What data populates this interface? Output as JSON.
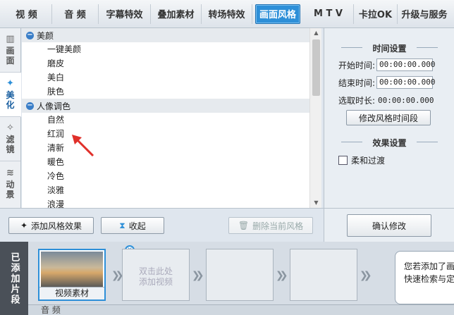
{
  "top_tabs": [
    {
      "label": "视 频"
    },
    {
      "label": "音 频"
    },
    {
      "label": "字幕特效"
    },
    {
      "label": "叠加素材"
    },
    {
      "label": "转场特效"
    },
    {
      "label": "画面风格"
    },
    {
      "label": "M T V"
    },
    {
      "label": "卡拉OK"
    },
    {
      "label": "升级与服务"
    }
  ],
  "side_tabs": [
    {
      "label": "画面",
      "icon": "film-icon"
    },
    {
      "label": "美化",
      "icon": "magic-wand-icon"
    },
    {
      "label": "滤镜",
      "icon": "sparkle-wand-icon"
    },
    {
      "label": "动景",
      "icon": "wave-icon"
    }
  ],
  "tree": {
    "group1": {
      "label": "美颜",
      "items": [
        "一键美颜",
        "磨皮",
        "美白",
        "肤色"
      ]
    },
    "group2": {
      "label": "人像调色",
      "items": [
        "自然",
        "红润",
        "清新",
        "暖色",
        "冷色",
        "淡雅",
        "浪漫"
      ]
    }
  },
  "settings": {
    "time_title": "时间设置",
    "start_label": "开始时间:",
    "start_value": "00:00:00.000",
    "end_label": "结束时间:",
    "end_value": "00:00:00.000",
    "duration_label": "选取时长:",
    "duration_value": "00:00:00.000",
    "modify_time_button": "修改风格时间段",
    "effect_title": "效果设置",
    "fade_label": "柔和过渡",
    "fade_checked": false
  },
  "toolbar": {
    "add_style_button": "添加风格效果",
    "collapse_button": "收起",
    "delete_style_button": "删除当前风格",
    "confirm_button": "确认修改"
  },
  "clips": {
    "side_label": "已添加片段",
    "first_clip_caption": "视频素材",
    "placeholder_text_line1": "双击此处",
    "placeholder_text_line2": "添加视频",
    "tip_line1": "您若添加了画",
    "tip_line2": "快速检索与定"
  },
  "audio_track_label": "音 频",
  "colors": {
    "accent": "#2d8fd8",
    "annotation_arrow": "#e0302a"
  }
}
